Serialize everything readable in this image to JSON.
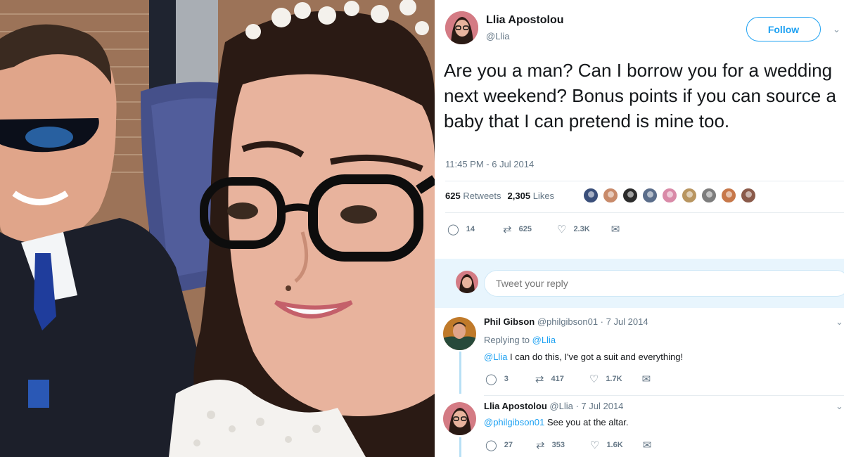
{
  "tweet": {
    "author_name": "Llia Apostolou",
    "author_handle": "@Llia",
    "follow_label": "Follow",
    "text": "Are you a man? Can I borrow you for a wedding next weekend? Bonus points if you can source a baby that I can pretend is mine too.",
    "timestamp": "11:45 PM - 6 Jul 2014",
    "retweets_count": "625",
    "retweets_label": "Retweets",
    "likes_count": "2,305",
    "likes_label": "Likes",
    "actions": {
      "replies": "14",
      "retweets": "625",
      "likes": "2.3K"
    }
  },
  "likers": {
    "colors": [
      "#3a4f7a",
      "#c88a6a",
      "#2b2b2b",
      "#5a6d8a",
      "#d98aa8",
      "#b89560",
      "#7d7d7d",
      "#c7784a",
      "#8a5a4a"
    ]
  },
  "reply_box": {
    "placeholder": "Tweet your reply"
  },
  "replies": [
    {
      "name": "Phil Gibson",
      "handle_date": "@philgibson01 · 7 Jul 2014",
      "replying_prefix": "Replying to",
      "replying_to": "@Llia",
      "mention": "@Llia",
      "text": " I can do this, I've got a suit and everything!",
      "actions": {
        "replies": "3",
        "retweets": "417",
        "likes": "1.7K"
      }
    },
    {
      "name": "Llia Apostolou",
      "handle_date": "@Llia · 7 Jul 2014",
      "mention": "@philgibson01",
      "text": " See you at the altar.",
      "actions": {
        "replies": "27",
        "retweets": "353",
        "likes": "1.6K"
      }
    }
  ],
  "icons": {
    "reply": "reply-icon",
    "retweet": "retweet-icon",
    "like": "heart-icon",
    "share": "direct-message-icon",
    "more": "chevron-down-icon"
  },
  "colors": {
    "accent": "#1da1f2",
    "muted": "#657786",
    "reply_bg": "#e8f5fd"
  }
}
